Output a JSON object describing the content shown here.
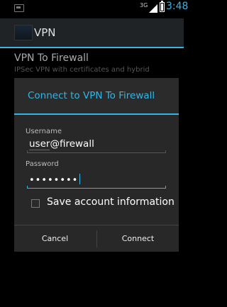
{
  "status_bar": {
    "network_type": "3G",
    "time": "3:48"
  },
  "action_bar": {
    "title": "VPN"
  },
  "background_item": {
    "title": "VPN To Firewall",
    "subtitle": "IPSec VPN with certificates and hybrid"
  },
  "dialog": {
    "title": "Connect to VPN To Firewall",
    "username_label": "Username",
    "username_value": "user@firewall",
    "username_misspelled_part": "user",
    "username_rest": "@firewall",
    "password_label": "Password",
    "password_value": "••••••••",
    "save_label": "Save account information",
    "save_checked": false,
    "cancel_label": "Cancel",
    "connect_label": "Connect"
  },
  "colors": {
    "accent": "#33b5e5",
    "dialog_bg": "#282828",
    "spellcheck": "#dd3333"
  },
  "icons": {
    "status_left": "notification-icon",
    "signal": "signal-icon",
    "battery": "battery-icon",
    "app": "vpn-app-icon"
  }
}
